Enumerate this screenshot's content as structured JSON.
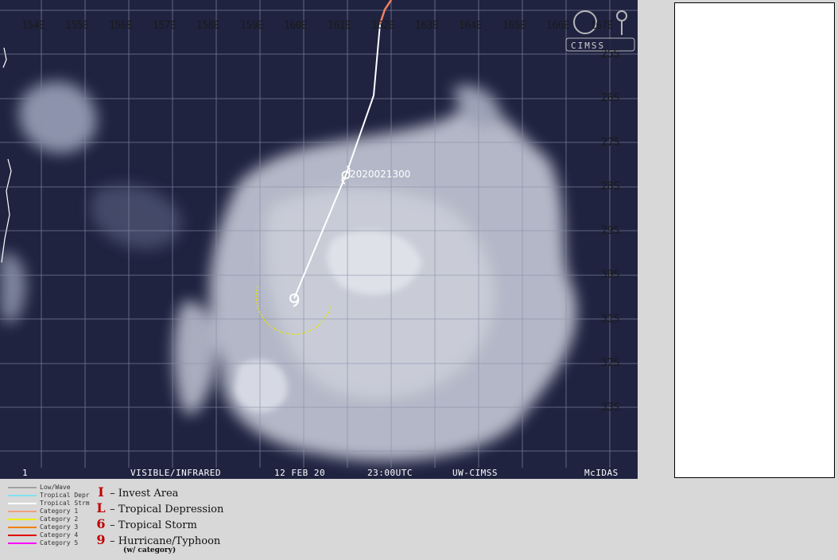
{
  "map": {
    "lon_labels": [
      "154E",
      "155E",
      "156E",
      "157E",
      "158E",
      "159E",
      "160E",
      "161E",
      "162E",
      "163E",
      "164E",
      "165E",
      "166E",
      "167E"
    ],
    "lat_labels": [
      "25S",
      "26S",
      "27S",
      "28S",
      "29S",
      "30S",
      "31S",
      "32S",
      "33S"
    ],
    "track_label": "2020021300",
    "logo_text": "CIMSS",
    "colors": {
      "ocean": "#1f2340",
      "grid": "#8a8fa8",
      "track": "#ffffff",
      "wind_radius": "#e6e600",
      "track_early": "#f08060"
    }
  },
  "status_bar": {
    "frame": "1",
    "product": "VISIBLE/INFRARED",
    "date": "12 FEB 20",
    "time": "23:00UTC",
    "source": "UW-CIMSS",
    "software": "McIDAS"
  },
  "legend": {
    "lines": [
      {
        "label": "Low/Wave",
        "color": "#a0a0a0"
      },
      {
        "label": "Tropical Depr",
        "color": "#80e0f0"
      },
      {
        "label": "Tropical Strm",
        "color": "#ffffff"
      },
      {
        "label": "Category 1",
        "color": "#f0a080"
      },
      {
        "label": "Category 2",
        "color": "#f0f000"
      },
      {
        "label": "Category 3",
        "color": "#f08000"
      },
      {
        "label": "Category 4",
        "color": "#e00000"
      },
      {
        "label": "Category 5",
        "color": "#ff00ff"
      }
    ],
    "symbols": [
      {
        "glyph": "I",
        "label": "– Invest Area"
      },
      {
        "glyph": "L",
        "label": "– Tropical Depression"
      },
      {
        "glyph": "6",
        "label": "– Tropical Storm"
      },
      {
        "glyph": "9",
        "label": "– Hurricane/Typhoon"
      }
    ],
    "note": "(w/ category)"
  }
}
